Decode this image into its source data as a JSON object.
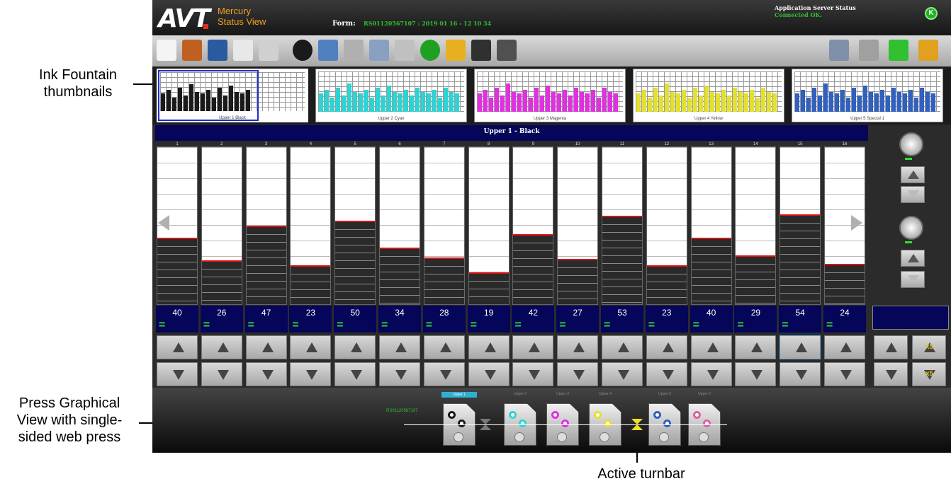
{
  "annotations": {
    "thumbnails": "Ink Fountain\nthumbnails",
    "press_view": "Press Graphical\nView with single-\nsided web press",
    "turnbar": "Active turnbar"
  },
  "header": {
    "logo": "AVT",
    "app_name_line1": "Mercury",
    "app_name_line2": "Status View",
    "form_label": "Form:",
    "form_value": "RS01120567107 : 2019 01 16 - 12 10 34",
    "server_title": "Application Server Status",
    "server_status": "Connected OK.",
    "status_icon_letter": "K"
  },
  "toolbar": {
    "icons": [
      "new-icon",
      "open-icon",
      "save-icon",
      "print-preview-icon",
      "ops-icon",
      "percent-icon",
      "copy-icon",
      "paste-icon",
      "refresh-icon",
      "compare-icon",
      "approve-icon",
      "lock-icon",
      "report-icon",
      "press-icon"
    ],
    "right_icons": [
      "tools-icon",
      "wrench-icon",
      "sync-icon",
      "padlock-icon"
    ]
  },
  "thumbnails": [
    {
      "label": "Upper 1 Black",
      "color": "#1a1a1a",
      "selected": true
    },
    {
      "label": "Upper 2 Cyan",
      "color": "#2cd4d4",
      "selected": false
    },
    {
      "label": "Upper 3 Magenta",
      "color": "#e030e0",
      "selected": false
    },
    {
      "label": "Upper 4 Yellow",
      "color": "#e4e030",
      "selected": false
    },
    {
      "label": "Upper 5 Special 1",
      "color": "#3060c0",
      "selected": false
    }
  ],
  "panel": {
    "title": "Upper 1 - Black",
    "zones": [
      {
        "num": "1",
        "value": 40
      },
      {
        "num": "2",
        "value": 26
      },
      {
        "num": "3",
        "value": 47
      },
      {
        "num": "4",
        "value": 23
      },
      {
        "num": "5",
        "value": 50
      },
      {
        "num": "6",
        "value": 34
      },
      {
        "num": "7",
        "value": 28
      },
      {
        "num": "8",
        "value": 19
      },
      {
        "num": "9",
        "value": 42
      },
      {
        "num": "10",
        "value": 27
      },
      {
        "num": "11",
        "value": 53
      },
      {
        "num": "12",
        "value": 23
      },
      {
        "num": "13",
        "value": 40
      },
      {
        "num": "14",
        "value": 29
      },
      {
        "num": "15",
        "value": 54
      },
      {
        "num": "16",
        "value": 24
      }
    ],
    "eq_symbol": "=",
    "x5_label": "x5"
  },
  "press": {
    "form_id": "RS01120567107",
    "units": [
      {
        "label": "Upper 1",
        "color": "#1a1a1a",
        "active": true
      },
      {
        "label": "Upper 2",
        "color": "#2cd4d4",
        "active": false
      },
      {
        "label": "Upper 3",
        "color": "#e030e0",
        "active": false
      },
      {
        "label": "Upper 4",
        "color": "#e4e030",
        "active": false
      },
      {
        "label": "Upper 5",
        "color": "#3060c0",
        "active": false
      },
      {
        "label": "Upper 6",
        "color": "#e060a0",
        "active": false
      }
    ]
  }
}
